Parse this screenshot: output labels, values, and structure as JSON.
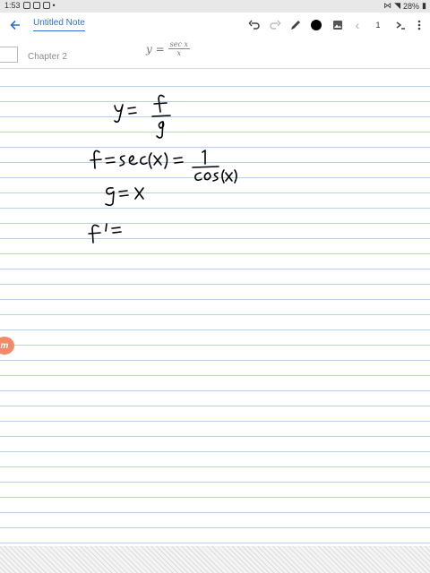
{
  "status": {
    "time": "1:53",
    "battery": "28%"
  },
  "toolbar": {
    "back_icon": "arrow-left-icon",
    "title": "Untitled Note",
    "undo_icon": "undo-icon",
    "redo_icon": "redo-icon",
    "pen_icon": "pen-icon",
    "color_icon": "color-dot-icon",
    "color": "#000000",
    "image_icon": "image-icon",
    "prev_icon": "chevron-left-icon",
    "page_number": "1",
    "next_icon": "next-page-icon",
    "menu_icon": "more-vertical-icon"
  },
  "note": {
    "chapter": "Chapter 2",
    "formula": {
      "lhs": "y =",
      "numerator": "sec x",
      "denominator": "x"
    },
    "handwriting": {
      "line1": {
        "text": "y = f/g"
      },
      "line2": {
        "text": "f = sec(x) = 1/cos(x)"
      },
      "line3": {
        "text": "g = x"
      },
      "line4": {
        "text": "f' ="
      }
    }
  },
  "side_badge": {
    "text": "m"
  },
  "colors": {
    "accent": "#2f6ed1",
    "rule_line": "#b9cfe8"
  }
}
